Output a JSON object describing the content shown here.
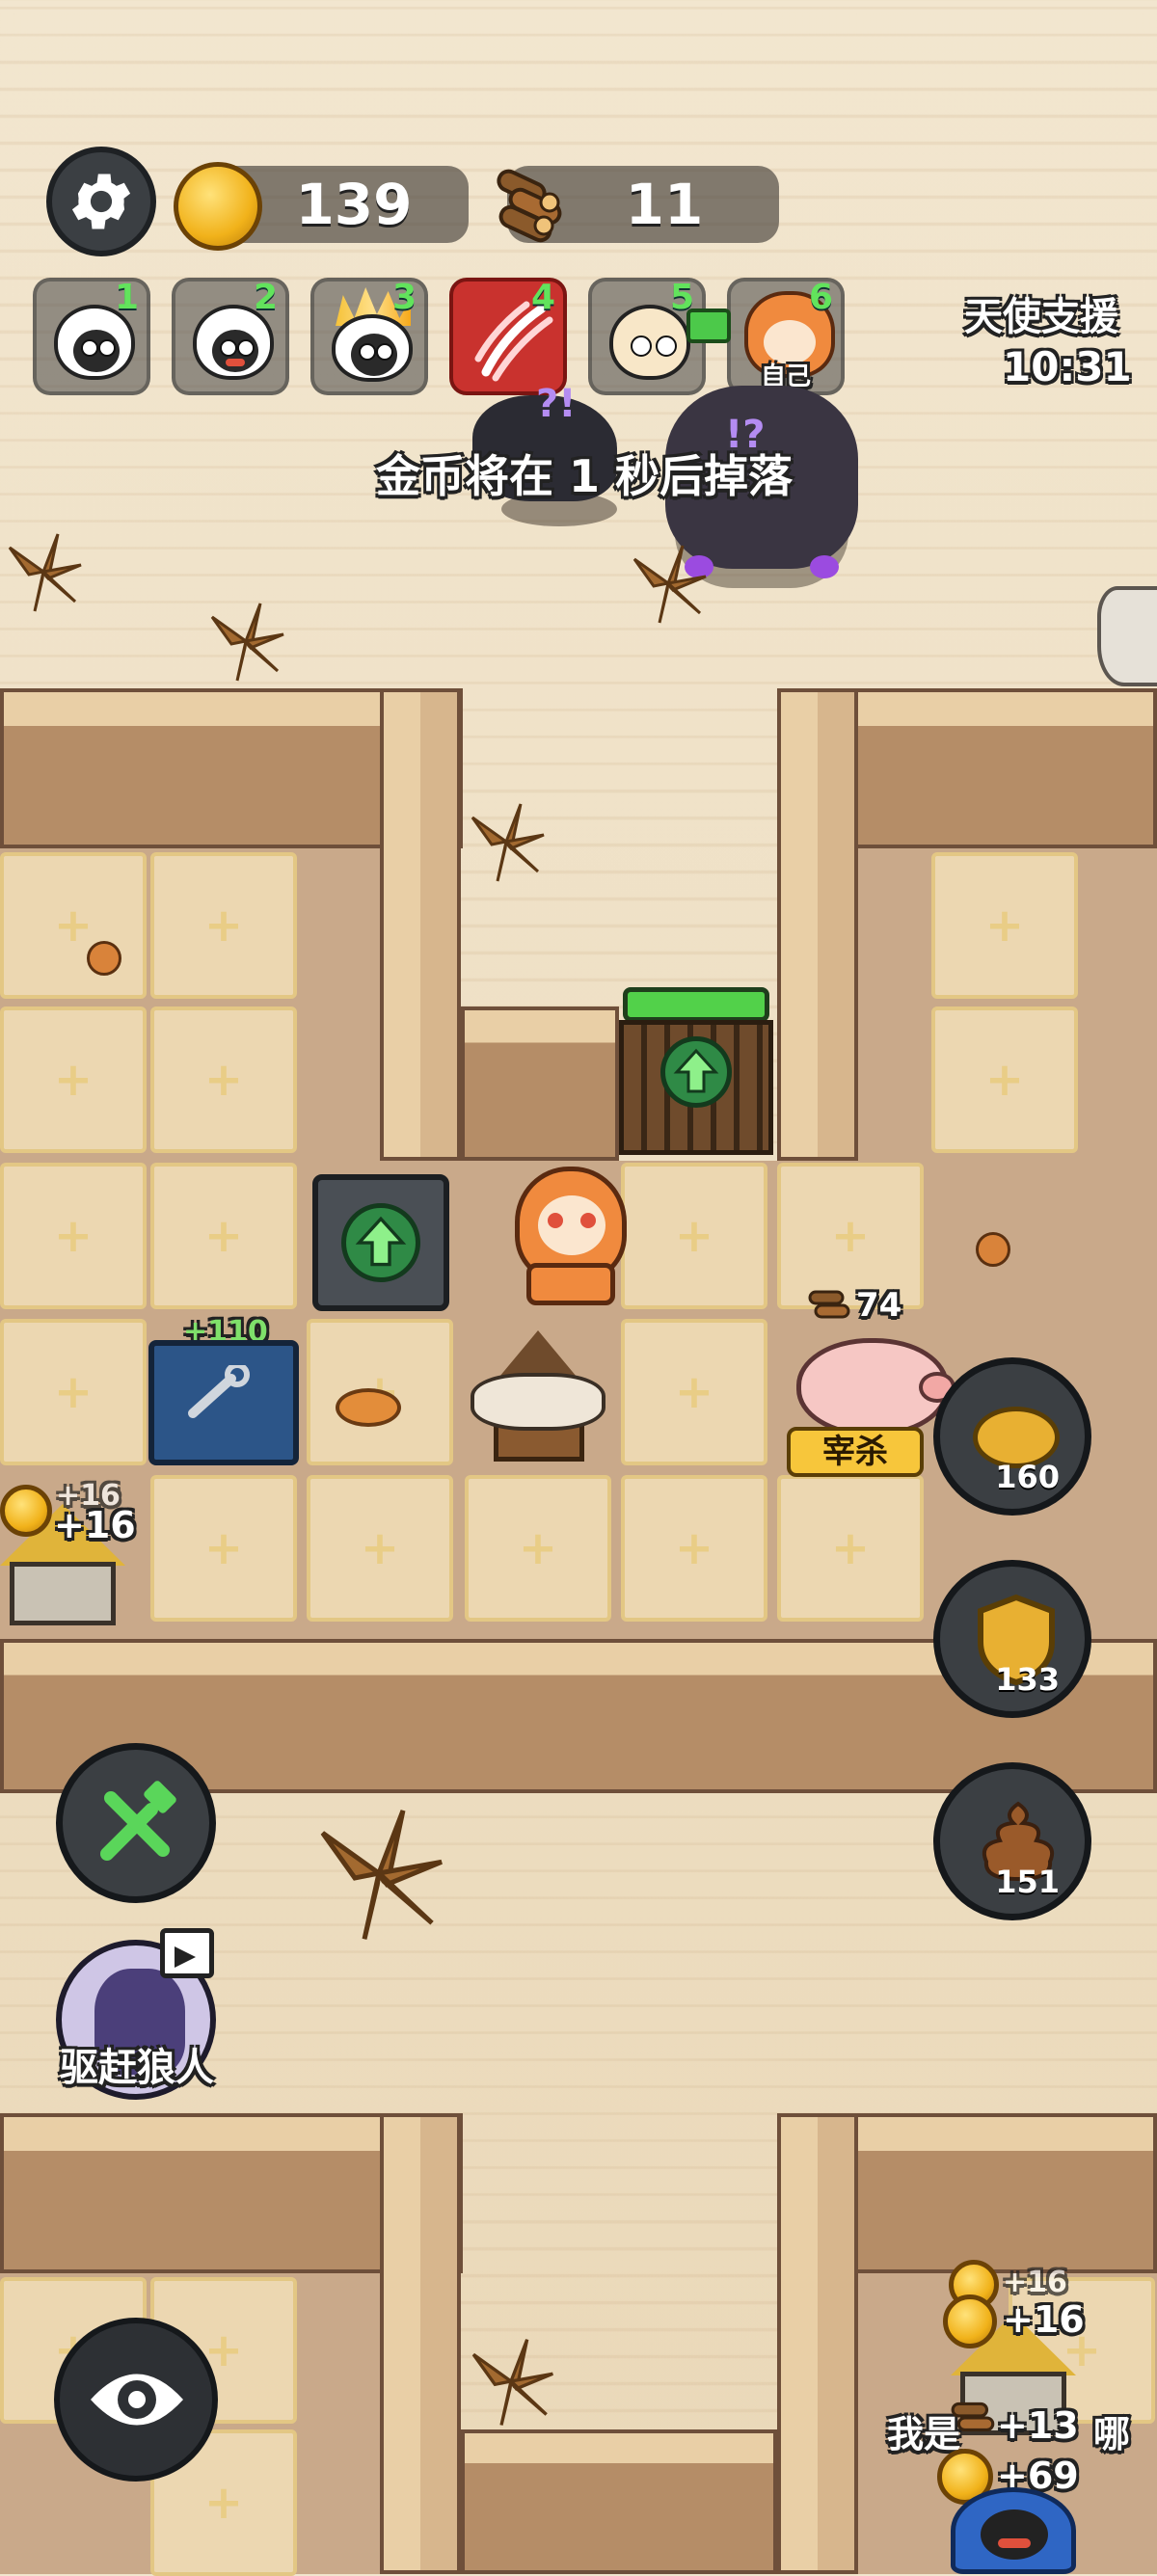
{
  "hud": {
    "gold": "139",
    "wood": "11",
    "settings_icon": "gear-icon"
  },
  "players": [
    {
      "num": "1",
      "label": ""
    },
    {
      "num": "2",
      "label": ""
    },
    {
      "num": "3",
      "label": ""
    },
    {
      "num": "4",
      "label": ""
    },
    {
      "num": "5",
      "label": ""
    },
    {
      "num": "6",
      "label": "自己"
    }
  ],
  "angel": {
    "label": "天使支援",
    "time": "10:31"
  },
  "notice": "金币将在 1 秒后掉落",
  "pig": {
    "wood": "74",
    "action_label": "宰杀"
  },
  "workbench_bonus": "+110",
  "hut_left": {
    "coin_a": "+16",
    "coin_b": "+16"
  },
  "side_buttons": [
    {
      "icon": "piggy-bank-icon",
      "value": "160"
    },
    {
      "icon": "shield-icon",
      "value": "133"
    },
    {
      "icon": "poop-icon",
      "value": "151"
    }
  ],
  "tools_icon": "wrench-hammer-icon",
  "werewolf_button": {
    "label": "驱赶狼人"
  },
  "eye_icon": "eye-icon",
  "bottom_right": {
    "coin_a": "+16",
    "coin_b": "+16",
    "wood": "+13",
    "name": "我是",
    "name_suffix": "哪",
    "coin_c": "+69"
  },
  "colors": {
    "accent_green": "#5cd35a",
    "gold": "#f1b21a",
    "hud_dark": "#3b3f43"
  }
}
